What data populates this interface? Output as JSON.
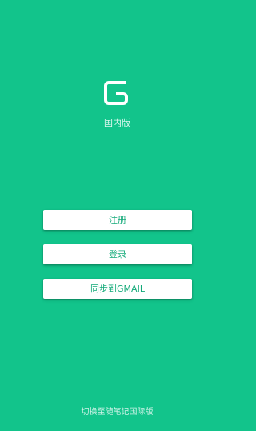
{
  "app": {
    "logo_icon": "gnotes-g-logo-icon",
    "edition_label": "国内版",
    "accent_color": "#12c48b",
    "button_text_color": "#12a978"
  },
  "actions": {
    "register_label": "注册",
    "login_label": "登录",
    "sync_gmail_label": "同步到GMAIL"
  },
  "footer": {
    "switch_label": "切换至随笔记国际版"
  }
}
